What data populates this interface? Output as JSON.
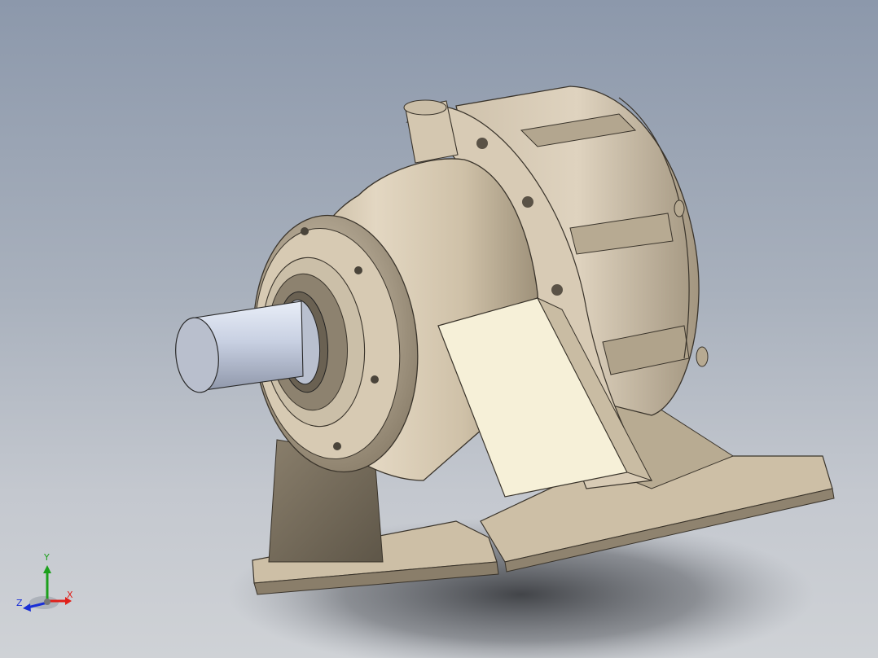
{
  "viewport": {
    "background_top": "#8c98ab",
    "background_bottom": "#cfd2d6",
    "model_color": "#d8cbb5",
    "shaft_color": "#c9d0e0",
    "selected_face_color": "#f6f0d8"
  },
  "triad": {
    "x_label": "X",
    "y_label": "Y",
    "z_label": "Z",
    "x_color": "#e0201a",
    "y_color": "#1ca01c",
    "z_color": "#1a2fd6"
  }
}
